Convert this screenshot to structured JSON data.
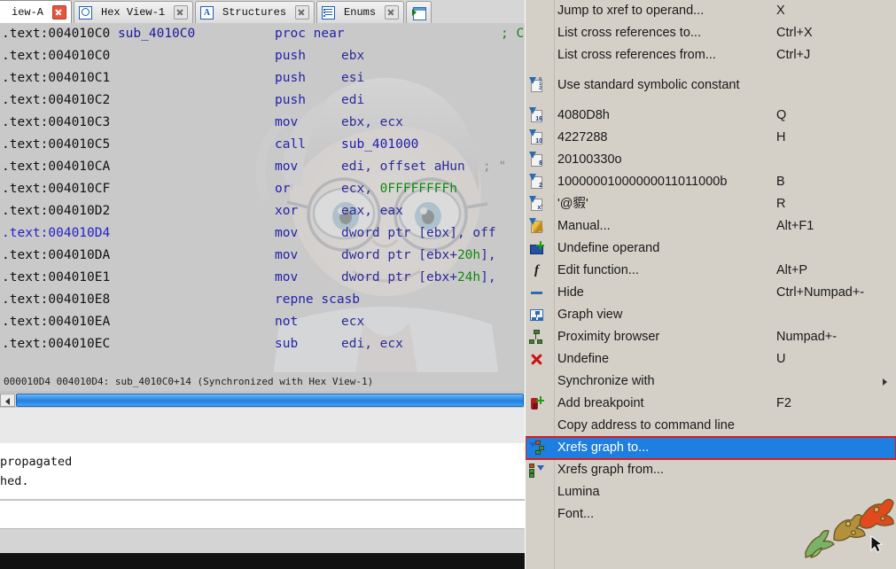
{
  "tabs": [
    {
      "label": "iew-A",
      "icon": "none",
      "close": "close-icon-red",
      "active": true
    },
    {
      "label": "Hex View-1",
      "icon": "hex-view-icon",
      "close": "close-icon"
    },
    {
      "label": "Structures",
      "icon": "structures-icon",
      "close": "close-icon"
    },
    {
      "label": "Enums",
      "icon": "enums-icon",
      "close": "close-icon"
    },
    {
      "label": "",
      "icon": "imports-icon",
      "close": ""
    }
  ],
  "disassembly": {
    "lines": [
      {
        "addr": ".text:004010C0",
        "name": "sub_4010C0",
        "mnemonic": "proc near",
        "operands": "",
        "comment": "; CO",
        "current": false
      },
      {
        "addr": ".text:004010C0",
        "name": "",
        "mnemonic": "push",
        "operands": "ebx",
        "comment": "",
        "current": false
      },
      {
        "addr": ".text:004010C1",
        "name": "",
        "mnemonic": "push",
        "operands": "esi",
        "comment": "",
        "current": false
      },
      {
        "addr": ".text:004010C2",
        "name": "",
        "mnemonic": "push",
        "operands": "edi",
        "comment": "",
        "current": false
      },
      {
        "addr": ".text:004010C3",
        "name": "",
        "mnemonic": "mov",
        "operands": "ebx, ecx",
        "comment": "",
        "current": false
      },
      {
        "addr": ".text:004010C5",
        "name": "",
        "mnemonic": "call",
        "operands": "sub_401000",
        "comment": "",
        "current": false
      },
      {
        "addr": ".text:004010CA",
        "name": "",
        "mnemonic": "mov",
        "operands": "edi, offset aHun",
        "comment": "; \"",
        "current": false
      },
      {
        "addr": ".text:004010CF",
        "name": "",
        "mnemonic": "or",
        "operands": "ecx, 0FFFFFFFFh",
        "comment": "",
        "current": false
      },
      {
        "addr": ".text:004010D2",
        "name": "",
        "mnemonic": "xor",
        "operands": "eax, eax",
        "comment": "",
        "current": false
      },
      {
        "addr": ".text:004010D4",
        "name": "",
        "mnemonic": "mov",
        "operands": "dword ptr [ebx], off",
        "comment": "",
        "current": true
      },
      {
        "addr": ".text:004010DA",
        "name": "",
        "mnemonic": "mov",
        "operands": "dword ptr [ebx+20h],",
        "comment": "",
        "current": false
      },
      {
        "addr": ".text:004010E1",
        "name": "",
        "mnemonic": "mov",
        "operands": "dword ptr [ebx+24h],",
        "comment": "",
        "current": false
      },
      {
        "addr": ".text:004010E8",
        "name": "",
        "mnemonic": "repne scasb",
        "operands": "",
        "comment": "",
        "current": false
      },
      {
        "addr": ".text:004010EA",
        "name": "",
        "mnemonic": "not",
        "operands": "ecx",
        "comment": "",
        "current": false
      },
      {
        "addr": ".text:004010EC",
        "name": "",
        "mnemonic": "sub",
        "operands": "edi, ecx",
        "comment": "",
        "current": false
      }
    ]
  },
  "sync_status": "000010D4 004010D4: sub_4010C0+14 (Synchronized with Hex View-1)",
  "output": {
    "line1": "propagated",
    "line2": "hed."
  },
  "context_menu": {
    "items": [
      {
        "label": "Jump to xref to operand...",
        "accel": "X",
        "icon": "none"
      },
      {
        "label": "List cross references to...",
        "accel": "Ctrl+X",
        "icon": "none"
      },
      {
        "label": "List cross references from...",
        "accel": "Ctrl+J",
        "icon": "none"
      },
      {
        "separator": true
      },
      {
        "label": "Use standard symbolic constant",
        "accel": "",
        "icon": "symbolic-constant-icon"
      },
      {
        "separator": true
      },
      {
        "label": "4080D8h",
        "accel": "Q",
        "icon": "hex-radix-icon"
      },
      {
        "label": "4227288",
        "accel": "H",
        "icon": "decimal-radix-icon"
      },
      {
        "label": "20100330o",
        "accel": "",
        "icon": "octal-radix-icon"
      },
      {
        "label": "10000001000000011011000b",
        "accel": "B",
        "icon": "binary-radix-icon"
      },
      {
        "label": "'@貑'",
        "accel": "R",
        "icon": "char-radix-icon"
      },
      {
        "label": "Manual...",
        "accel": "Alt+F1",
        "icon": "manual-icon"
      },
      {
        "label": "Undefine operand",
        "accel": "",
        "icon": "undefine-operand-icon"
      },
      {
        "label": "Edit function...",
        "accel": "Alt+P",
        "icon": "edit-function-icon"
      },
      {
        "label": "Hide",
        "accel": "Ctrl+Numpad+-",
        "icon": "hide-icon"
      },
      {
        "label": "Graph view",
        "accel": "",
        "icon": "graph-view-icon"
      },
      {
        "label": "Proximity browser",
        "accel": "Numpad+-",
        "icon": "proximity-browser-icon"
      },
      {
        "label": "Undefine",
        "accel": "U",
        "icon": "undefine-icon"
      },
      {
        "label": "Synchronize with",
        "accel": "",
        "icon": "none",
        "submenu": true
      },
      {
        "label": "Add breakpoint",
        "accel": "F2",
        "icon": "add-breakpoint-icon"
      },
      {
        "label": "Copy address to command line",
        "accel": "",
        "icon": "none"
      },
      {
        "label": "Xrefs graph to...",
        "accel": "",
        "icon": "xrefs-graph-to-icon",
        "selected": true
      },
      {
        "label": "Xrefs graph from...",
        "accel": "",
        "icon": "xrefs-graph-from-icon"
      },
      {
        "label": "Lumina",
        "accel": "",
        "icon": "none"
      },
      {
        "label": "Font...",
        "accel": "",
        "icon": "none"
      }
    ]
  },
  "colors": {
    "menu_bg": "#d4d0c8",
    "selection_blue": "#1f7fe0",
    "selection_border_red": "#e01b1b",
    "disasm_bg": "#c9c9c9",
    "addr_current": "#2222cc",
    "mnemonic": "#2222aa",
    "number_green": "#118811",
    "comment_green": "#118811"
  }
}
